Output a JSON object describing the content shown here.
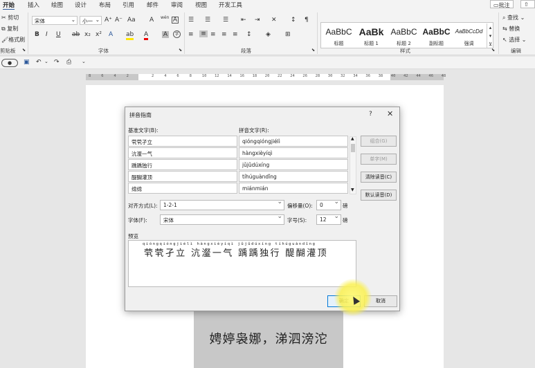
{
  "tabs": [
    "开始",
    "插入",
    "绘图",
    "设计",
    "布局",
    "引用",
    "邮件",
    "审阅",
    "视图",
    "开发工具"
  ],
  "tab_buttons": {
    "comment": "批注",
    "share": "共享"
  },
  "clipboard": {
    "cut": "剪切",
    "copy": "复制",
    "format_painter": "格式刷",
    "group": "剪贴板"
  },
  "font": {
    "name": "宋体",
    "size": "小一",
    "grow": "A⁺",
    "shrink": "A⁻",
    "case": "Aa",
    "clear": "A",
    "pinyin": "wén",
    "border": "A",
    "bold": "B",
    "italic": "I",
    "underline": "U",
    "strike": "ab",
    "sub": "x₂",
    "sup": "x²",
    "effects": "A",
    "highlight": "ab",
    "color": "A",
    "shading": "A",
    "enclose": "字",
    "group": "字体"
  },
  "paragraph": {
    "group": "段落"
  },
  "styles": {
    "items": [
      {
        "sample": "AaBbC",
        "name": "标题"
      },
      {
        "sample": "AaBk",
        "name": "标题 1"
      },
      {
        "sample": "AaBbC",
        "name": "标题 2"
      },
      {
        "sample": "AaBbC",
        "name": "副标题"
      },
      {
        "sample": "AaBbCcDd",
        "name": "强调"
      }
    ],
    "group": "样式"
  },
  "editing": {
    "find": "查找",
    "replace": "替换",
    "select": "选择",
    "group": "编辑"
  },
  "ruler_ticks": [
    "8",
    "6",
    "4",
    "2",
    "",
    "2",
    "4",
    "6",
    "8",
    "10",
    "12",
    "14",
    "16",
    "18",
    "20",
    "22",
    "24",
    "26",
    "28",
    "30",
    "32",
    "34",
    "36",
    "38",
    "40",
    "42",
    "44",
    "46",
    "48"
  ],
  "dialog": {
    "title": "拼音指南",
    "help": "?",
    "close": "✕",
    "base_label": "基准文字(B):",
    "ruby_label": "拼音文字(R):",
    "rows": [
      {
        "base": "茕茕孑立",
        "ruby": "qióngqióngjiélì"
      },
      {
        "base": "沆瀣一气",
        "ruby": "hàngxièyíqì"
      },
      {
        "base": "踽踽独行",
        "ruby": "jǔjǔdúxíng"
      },
      {
        "base": "醍醐灌顶",
        "ruby": "tíhúguàndǐng"
      },
      {
        "base": "绵绵",
        "ruby": "miánmián"
      }
    ],
    "btn_group": "组合(G)",
    "btn_mono": "单字(M)",
    "btn_clear": "清除读音(C)",
    "btn_default": "默认读音(D)",
    "align_label": "对齐方式(L):",
    "align_value": "1-2-1",
    "offset_label": "偏移量(O):",
    "offset_value": "0",
    "offset_unit": "磅",
    "font_label": "字体(F):",
    "font_value": "宋体",
    "size_label": "字号(S):",
    "size_value": "12",
    "size_unit": "磅",
    "preview_label": "预览",
    "preview_pinyin": "qióngqióngjiélì  hàngxièyíqì  jǔjǔdúxíng  tíhúguàndǐng",
    "preview_text": "茕茕孑立 沆瀣一气 踽踽独行 醍醐灌顶",
    "ok": "确定",
    "cancel": "取消"
  },
  "document_text": "娉婷袅娜，涕泗滂沱"
}
